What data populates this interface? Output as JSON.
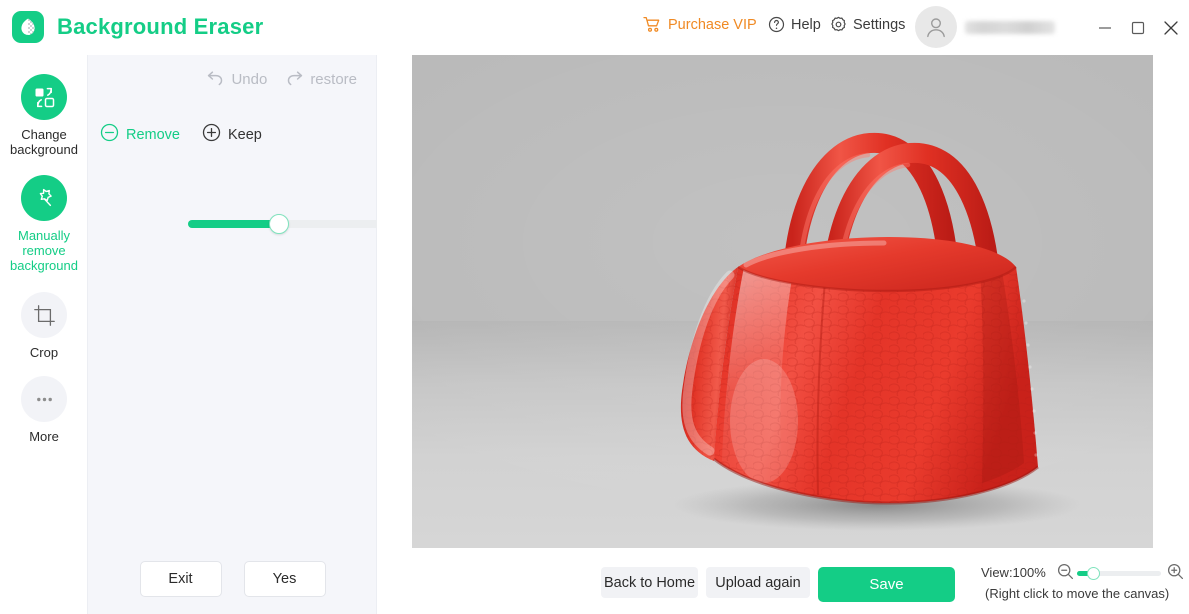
{
  "app": {
    "title": "Background Eraser",
    "logo_icon": "leaf-transparency-icon",
    "accent_color": "#14cd86",
    "vip_color": "#f08a24"
  },
  "titlebar": {
    "purchase_vip": {
      "label": "Purchase VIP",
      "icon": "shopping-cart-icon"
    },
    "help": {
      "label": "Help",
      "icon": "question-circle-icon"
    },
    "settings": {
      "label": "Settings",
      "icon": "gear-icon"
    },
    "account": {
      "avatar_icon": "user-avatar-icon",
      "username": "",
      "username_redacted": true
    },
    "window_controls": {
      "minimize": {
        "icon": "minimize-icon"
      },
      "maximize": {
        "icon": "maximize-icon"
      },
      "close": {
        "icon": "close-icon"
      }
    }
  },
  "sidebar": {
    "items": [
      {
        "label": "Change background",
        "icon": "swap-background-icon",
        "active": false
      },
      {
        "label": "Manually remove background",
        "icon": "magic-wand-icon",
        "active": true
      },
      {
        "label": "Crop",
        "icon": "crop-icon",
        "active": false
      },
      {
        "label": "More",
        "icon": "ellipsis-icon",
        "active": false
      }
    ]
  },
  "panel": {
    "history": [
      {
        "label": "Undo",
        "icon": "undo-arrow-icon",
        "enabled": false
      },
      {
        "label": "restore",
        "icon": "redo-arrow-icon",
        "enabled": false
      }
    ],
    "modes": [
      {
        "label": "Remove",
        "icon": "minus-circle-icon",
        "active": true
      },
      {
        "label": "Keep",
        "icon": "plus-circle-icon",
        "active": false
      }
    ],
    "brush_size": {
      "value": "15",
      "percent": 41,
      "min": 1,
      "max": 36
    },
    "actions": [
      {
        "label": "Exit"
      },
      {
        "label": "Yes"
      }
    ]
  },
  "canvas": {
    "subject": "red-leather-handbag",
    "background_color": "#b9b9b9",
    "subject_color": "#e8392c"
  },
  "bottombar": {
    "back_home": {
      "label": "Back to Home"
    },
    "upload_again": {
      "label": "Upload again"
    },
    "save": {
      "label": "Save"
    },
    "view": {
      "label": "View:100%",
      "zoom_percent": 100,
      "slider_percent": 20,
      "zoom_out_icon": "zoom-out-icon",
      "zoom_in_icon": "zoom-in-icon",
      "hint": "(Right click to move the canvas)"
    }
  }
}
